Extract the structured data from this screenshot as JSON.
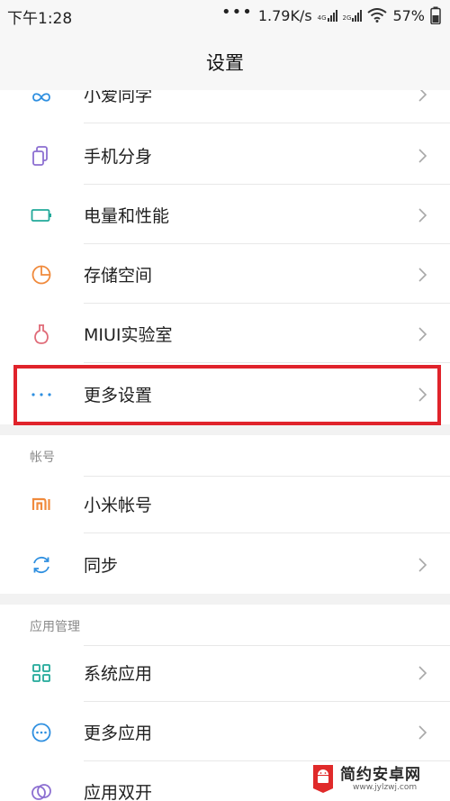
{
  "status": {
    "time": "下午1:28",
    "dots": "•••",
    "speed": "1.79K/s",
    "battery": "57%"
  },
  "header": {
    "title": "设置"
  },
  "items_top": [
    {
      "label": "小爱同学",
      "icon": "xiaoai-icon"
    },
    {
      "label": "手机分身",
      "icon": "second-space-icon"
    },
    {
      "label": "电量和性能",
      "icon": "battery-icon"
    },
    {
      "label": "存储空间",
      "icon": "storage-pie-icon"
    },
    {
      "label": "MIUI实验室",
      "icon": "flask-icon"
    },
    {
      "label": "更多设置",
      "icon": "more-dots-icon"
    }
  ],
  "sections": [
    {
      "title": "帐号",
      "items": [
        {
          "label": "小米帐号",
          "icon": "mi-logo-icon"
        },
        {
          "label": "同步",
          "icon": "sync-icon"
        }
      ]
    },
    {
      "title": "应用管理",
      "items": [
        {
          "label": "系统应用",
          "icon": "grid-apps-icon"
        },
        {
          "label": "更多应用",
          "icon": "more-apps-icon"
        },
        {
          "label": "应用双开",
          "icon": "dual-apps-icon"
        }
      ]
    }
  ],
  "watermark": {
    "title": "简约安卓网",
    "url": "www.jylzwj.com"
  },
  "colors": {
    "highlight": "#e0232b",
    "icon_blue": "#2e8fe0",
    "icon_purple": "#8c6fd1",
    "icon_teal": "#22a99a",
    "icon_orange": "#f08a3c",
    "icon_pink": "#e06b78"
  }
}
